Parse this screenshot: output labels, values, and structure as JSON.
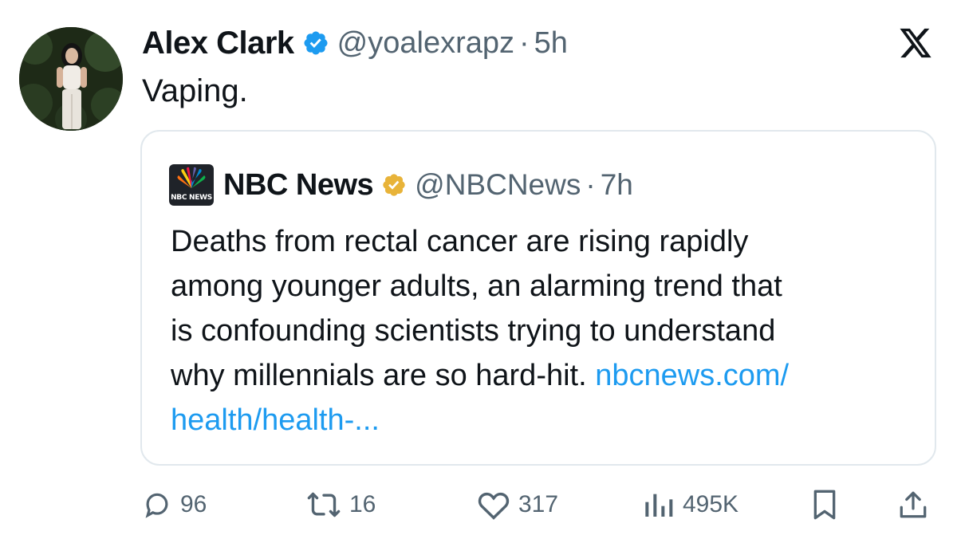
{
  "author": {
    "name": "Alex Clark",
    "handle": "@yoalexrapz",
    "separator": "·",
    "time": "5h",
    "avatar_icon": "profile-photo",
    "verified_color": "#1d9bf0"
  },
  "tweet": {
    "text": "Vaping."
  },
  "quoted": {
    "logo_text": "NBC NEWS",
    "name": "NBC News",
    "handle": "@NBCNews",
    "separator": "·",
    "time": "7h",
    "verified_color": "#e8b339",
    "body_lines": [
      "Deaths from rectal cancer are rising rapidly",
      "among younger adults, an alarming trend that",
      "is confounding scientists trying to understand",
      "why millennials are so hard-hit. "
    ],
    "link_part1": "nbcnews.com/",
    "link_part2": "health/health-..."
  },
  "actions": {
    "replies": "96",
    "reposts": "16",
    "likes": "317",
    "views": "495K"
  },
  "colors": {
    "secondary_text": "#536471",
    "link": "#1d9bf0",
    "border": "#e1e8ed"
  }
}
